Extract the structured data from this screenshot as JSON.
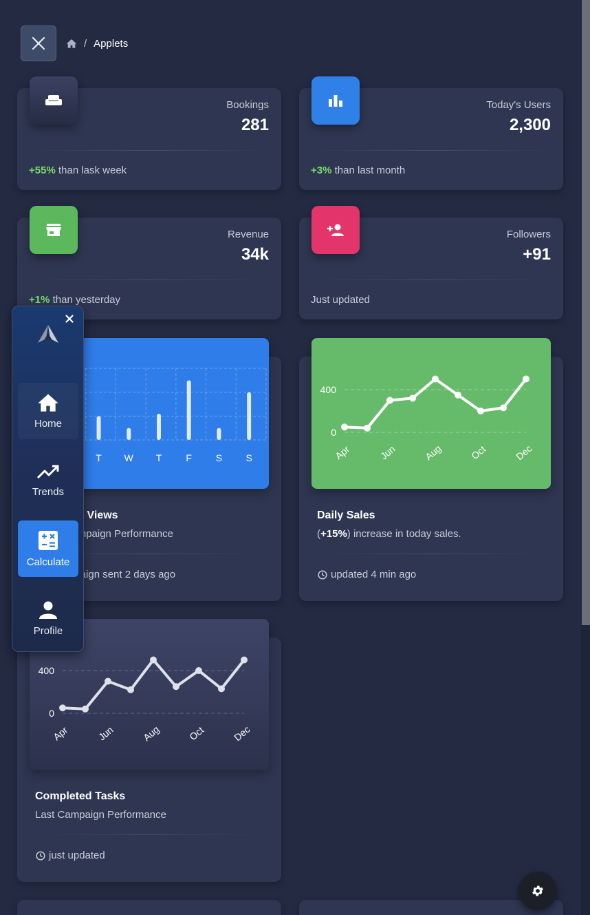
{
  "breadcrumb": {
    "current": "Applets"
  },
  "stats": [
    {
      "label": "Bookings",
      "value": "281",
      "pct": "+55%",
      "note": " than lask week",
      "icon": "sofa-icon",
      "color": "#2c3350"
    },
    {
      "label": "Today's Users",
      "value": "2,300",
      "pct": "+3%",
      "note": " than last month",
      "icon": "bar-chart-icon",
      "color": "#2f81e8"
    },
    {
      "label": "Revenue",
      "value": "34k",
      "pct": "+1%",
      "note": " than yesterday",
      "icon": "store-icon",
      "color": "#5cb85c"
    },
    {
      "label": "Followers",
      "value": "+91",
      "pct": "",
      "note": "Just updated",
      "icon": "person-add-icon",
      "color": "#e3346b"
    }
  ],
  "website_views": {
    "title": "Website Views",
    "subtitle": "Last Campaign Performance",
    "footer": "campaign sent 2 days ago",
    "chart_data": {
      "type": "bar",
      "categories": [
        "M",
        "T",
        "W",
        "T",
        "F",
        "S",
        "S"
      ],
      "values": [
        50,
        20,
        10,
        22,
        50,
        10,
        40
      ],
      "ylim": [
        0,
        60
      ],
      "grid": true
    }
  },
  "daily_sales": {
    "title": "Daily Sales",
    "subtitle_pct": "+15%",
    "subtitle_pre": "(",
    "subtitle_post": ") increase in today sales.",
    "footer": "updated 4 min ago",
    "chart_data": {
      "type": "line",
      "categories": [
        "Apr",
        "May",
        "Jun",
        "Jul",
        "Aug",
        "Sep",
        "Oct",
        "Nov",
        "Dec"
      ],
      "values": [
        50,
        40,
        300,
        320,
        500,
        350,
        200,
        230,
        500
      ],
      "yticks": [
        0,
        400
      ],
      "ylim": [
        0,
        600
      ],
      "xtick_labels": [
        "Apr",
        "Jun",
        "Aug",
        "Oct",
        "Dec"
      ],
      "grid": true
    }
  },
  "completed_tasks": {
    "title": "Completed Tasks",
    "subtitle": "Last Campaign Performance",
    "footer": "just updated",
    "chart_data": {
      "type": "line",
      "categories": [
        "Apr",
        "May",
        "Jun",
        "Jul",
        "Aug",
        "Sep",
        "Oct",
        "Nov",
        "Dec"
      ],
      "values": [
        50,
        40,
        300,
        220,
        500,
        250,
        400,
        230,
        500
      ],
      "yticks": [
        0,
        400
      ],
      "ylim": [
        0,
        600
      ],
      "xtick_labels": [
        "Apr",
        "Jun",
        "Aug",
        "Oct",
        "Dec"
      ],
      "grid": true
    }
  },
  "sidenav": {
    "items": [
      {
        "label": "Home",
        "icon": "home-icon"
      },
      {
        "label": "Trends",
        "icon": "trending-up-icon"
      },
      {
        "label": "Calculate",
        "icon": "calculator-icon",
        "active": true
      },
      {
        "label": "Profile",
        "icon": "person-icon"
      }
    ]
  }
}
